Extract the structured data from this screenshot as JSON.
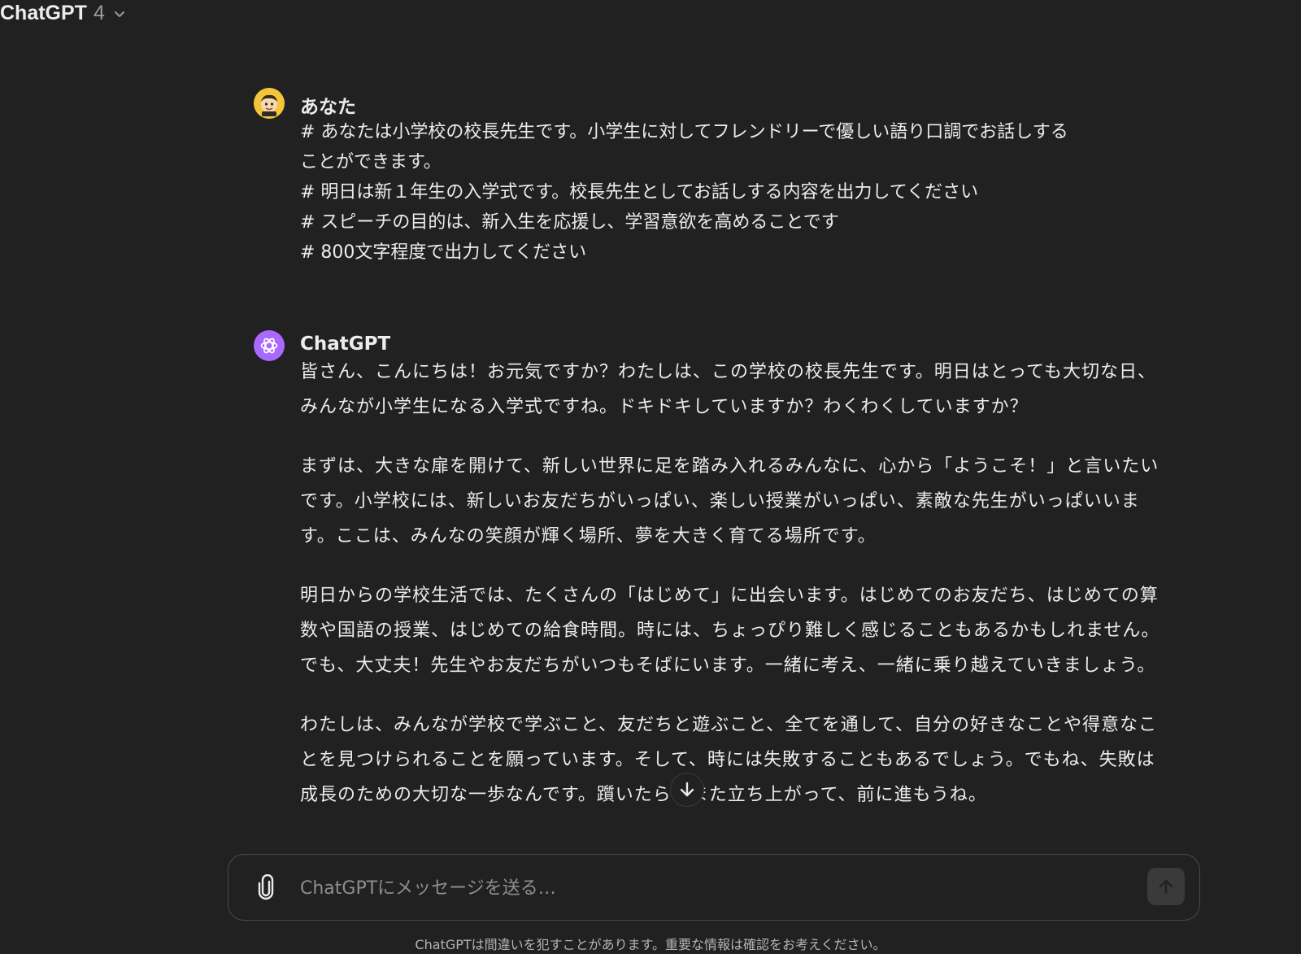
{
  "header": {
    "model_name": "ChatGPT",
    "model_version": "4"
  },
  "conversation": {
    "user_message": {
      "author": "あなた",
      "lines": [
        "# あなたは小学校の校長先生です。小学生に対してフレンドリーで優しい語り口調でお話しする",
        "ことができます。",
        "# 明日は新１年生の入学式です。校長先生としてお話しする内容を出力してください",
        "# スピーチの目的は、新入生を応援し、学習意欲を高めることです",
        "# 800文字程度で出力してください"
      ]
    },
    "assistant_message": {
      "author": "ChatGPT",
      "paragraphs": [
        "皆さん、こんにちは！お元気ですか？わたしは、この学校の校長先生です。明日はとっても大切な日、みんなが小学生になる入学式ですね。ドキドキしていますか？わくわくしていますか？",
        "まずは、大きな扉を開けて、新しい世界に足を踏み入れるみんなに、心から「ようこそ！」と言いたいです。小学校には、新しいお友だちがいっぱい、楽しい授業がいっぱい、素敵な先生がいっぱいいます。ここは、みんなの笑顔が輝く場所、夢を大きく育てる場所です。",
        "明日からの学校生活では、たくさんの「はじめて」に出会います。はじめてのお友だち、はじめての算数や国語の授業、はじめての給食時間。時には、ちょっぴり難しく感じることもあるかもしれません。でも、大丈夫！先生やお友だちがいつもそばにいます。一緒に考え、一緒に乗り越えていきましょう。",
        "わたしは、みんなが学校で学ぶこと、友だちと遊ぶこと、全てを通して、自分の好きなことや得意なことを見つけられることを願っています。そして、時には失敗することもあるでしょう。でもね、失敗は成長のための大切な一歩なんです。躓いたら、また立ち上がって、前に進もうね。"
      ]
    }
  },
  "composer": {
    "placeholder": "ChatGPTにメッセージを送る…"
  },
  "footer": {
    "disclaimer": "ChatGPTは間違いを犯すことがあります。重要な情報は確認をお考えください。"
  },
  "icons": {
    "chevron": "chevron-down-icon",
    "attach": "paperclip-icon",
    "send": "arrow-up-icon",
    "scroll": "arrow-down-icon",
    "gpt_logo": "openai-logo-icon"
  },
  "colors": {
    "background": "#212121",
    "text": "#ececec",
    "gpt_avatar": "#ab68ff",
    "user_avatar": "#f3c53a"
  }
}
